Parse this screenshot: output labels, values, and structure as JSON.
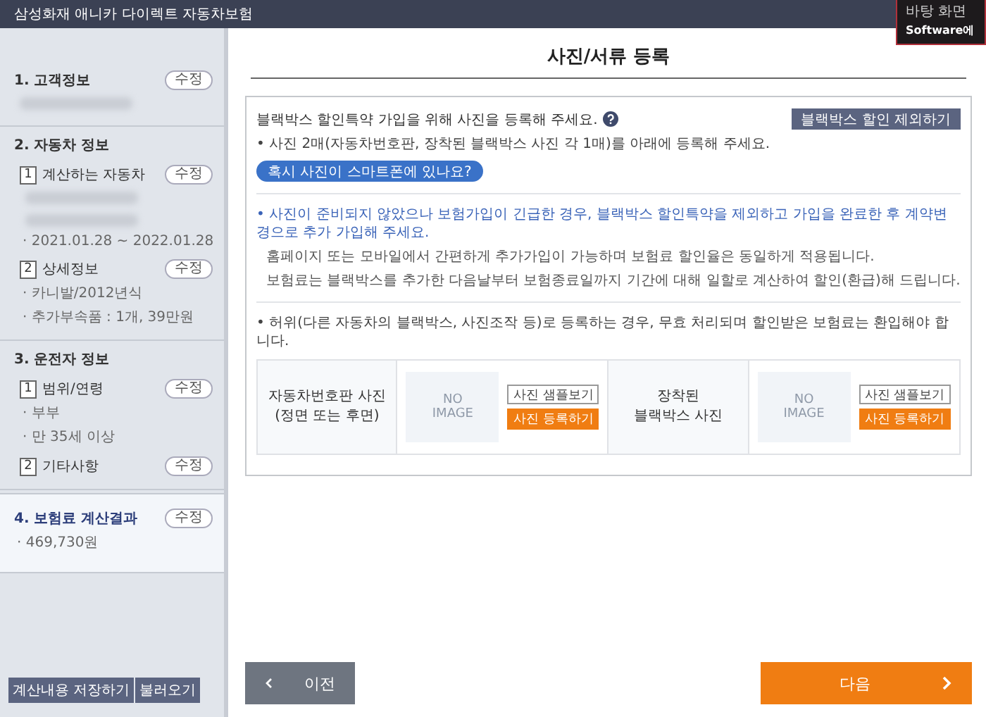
{
  "header": {
    "title": "삼성화재 애니카 다이렉트 자동차보험"
  },
  "notification": {
    "lines": [
      "바탕 화면",
      "Software에"
    ]
  },
  "sidebar": {
    "sections": [
      {
        "title": "1. 고객정보",
        "edit": "수정",
        "selected": false,
        "items": [
          {
            "kind": "blurred"
          }
        ]
      },
      {
        "title": "2. 자동차 정보",
        "selected": false,
        "subsections": [
          {
            "number": "1",
            "title": "계산하는 자동차",
            "edit": "수정",
            "items": [
              {
                "kind": "blurred"
              },
              {
                "kind": "blurred"
              },
              {
                "kind": "text",
                "text": "· 2021.01.28 ~ 2022.01.28"
              }
            ]
          },
          {
            "number": "2",
            "title": "상세정보",
            "edit": "수정",
            "items": [
              {
                "kind": "text",
                "text": "· 카니발/2012년식"
              },
              {
                "kind": "text",
                "text": "· 추가부속품 : 1개, 39만원"
              }
            ]
          }
        ]
      },
      {
        "title": "3. 운전자 정보",
        "selected": false,
        "subsections": [
          {
            "number": "1",
            "title": "범위/연령",
            "edit": "수정",
            "items": [
              {
                "kind": "text",
                "text": "· 부부"
              },
              {
                "kind": "text",
                "text": "· 만 35세 이상"
              }
            ]
          },
          {
            "number": "2",
            "title": "기타사항",
            "edit": "수정"
          }
        ]
      },
      {
        "title": "4. 보험료 계산결과",
        "edit": "수정",
        "selected": true,
        "items": [
          {
            "kind": "text",
            "text": "· 469,730원"
          }
        ]
      }
    ],
    "buttons": [
      "계산내용 저장하기",
      "불러오기"
    ]
  },
  "main": {
    "title": "사진/서류 등록",
    "notice": {
      "heading": "블랙박스 할인특약 가입을 위해 사진을 등록해 주세요.",
      "exclude_button": "블랙박스 할인 제외하기",
      "instruction": "• 사진 2매(자동차번호판, 장착된 블랙박스 사진 각 1매)를 아래에 등록해 주세요.",
      "smartphone_button": "혹시 사진이 스마트폰에 있나요?",
      "paragraphs": [
        {
          "kind": "highlight",
          "text": "• 사진이 준비되지 않았으나 보험가입이 긴급한 경우, 블랙박스 할인특약을 제외하고 가입을 완료한 후 계약변경으로 추가 가입해 주세요."
        },
        {
          "kind": "plain",
          "text": "홈페이지 또는 모바일에서 간편하게 추가가입이 가능하며 보험료 할인율은 동일하게 적용됩니다."
        },
        {
          "kind": "plain",
          "text": "보험료는 블랙박스를 추가한 다음날부터 보험종료일까지 기간에 대해 일할로 계산하여 할인(환급)해 드립니다."
        }
      ],
      "warning": "• 허위(다른 자동차의 블랙박스, 사진조작 등)로 등록하는 경우, 무효 처리되며 할인받은 보험료는 환입해야 합니다.",
      "photos": [
        {
          "label": [
            "자동차번호판 사진",
            "(정면 또는 후면)"
          ],
          "placeholder": [
            "NO",
            "IMAGE"
          ],
          "sample_button": "사진 샘플보기",
          "upload_button": "사진 등록하기"
        },
        {
          "label": [
            "장착된",
            "블랙박스 사진"
          ],
          "placeholder": [
            "NO",
            "IMAGE"
          ],
          "sample_button": "사진 샘플보기",
          "upload_button": "사진 등록하기"
        }
      ]
    }
  },
  "footer": {
    "prev_button": "이전",
    "next_button": "다음"
  }
}
